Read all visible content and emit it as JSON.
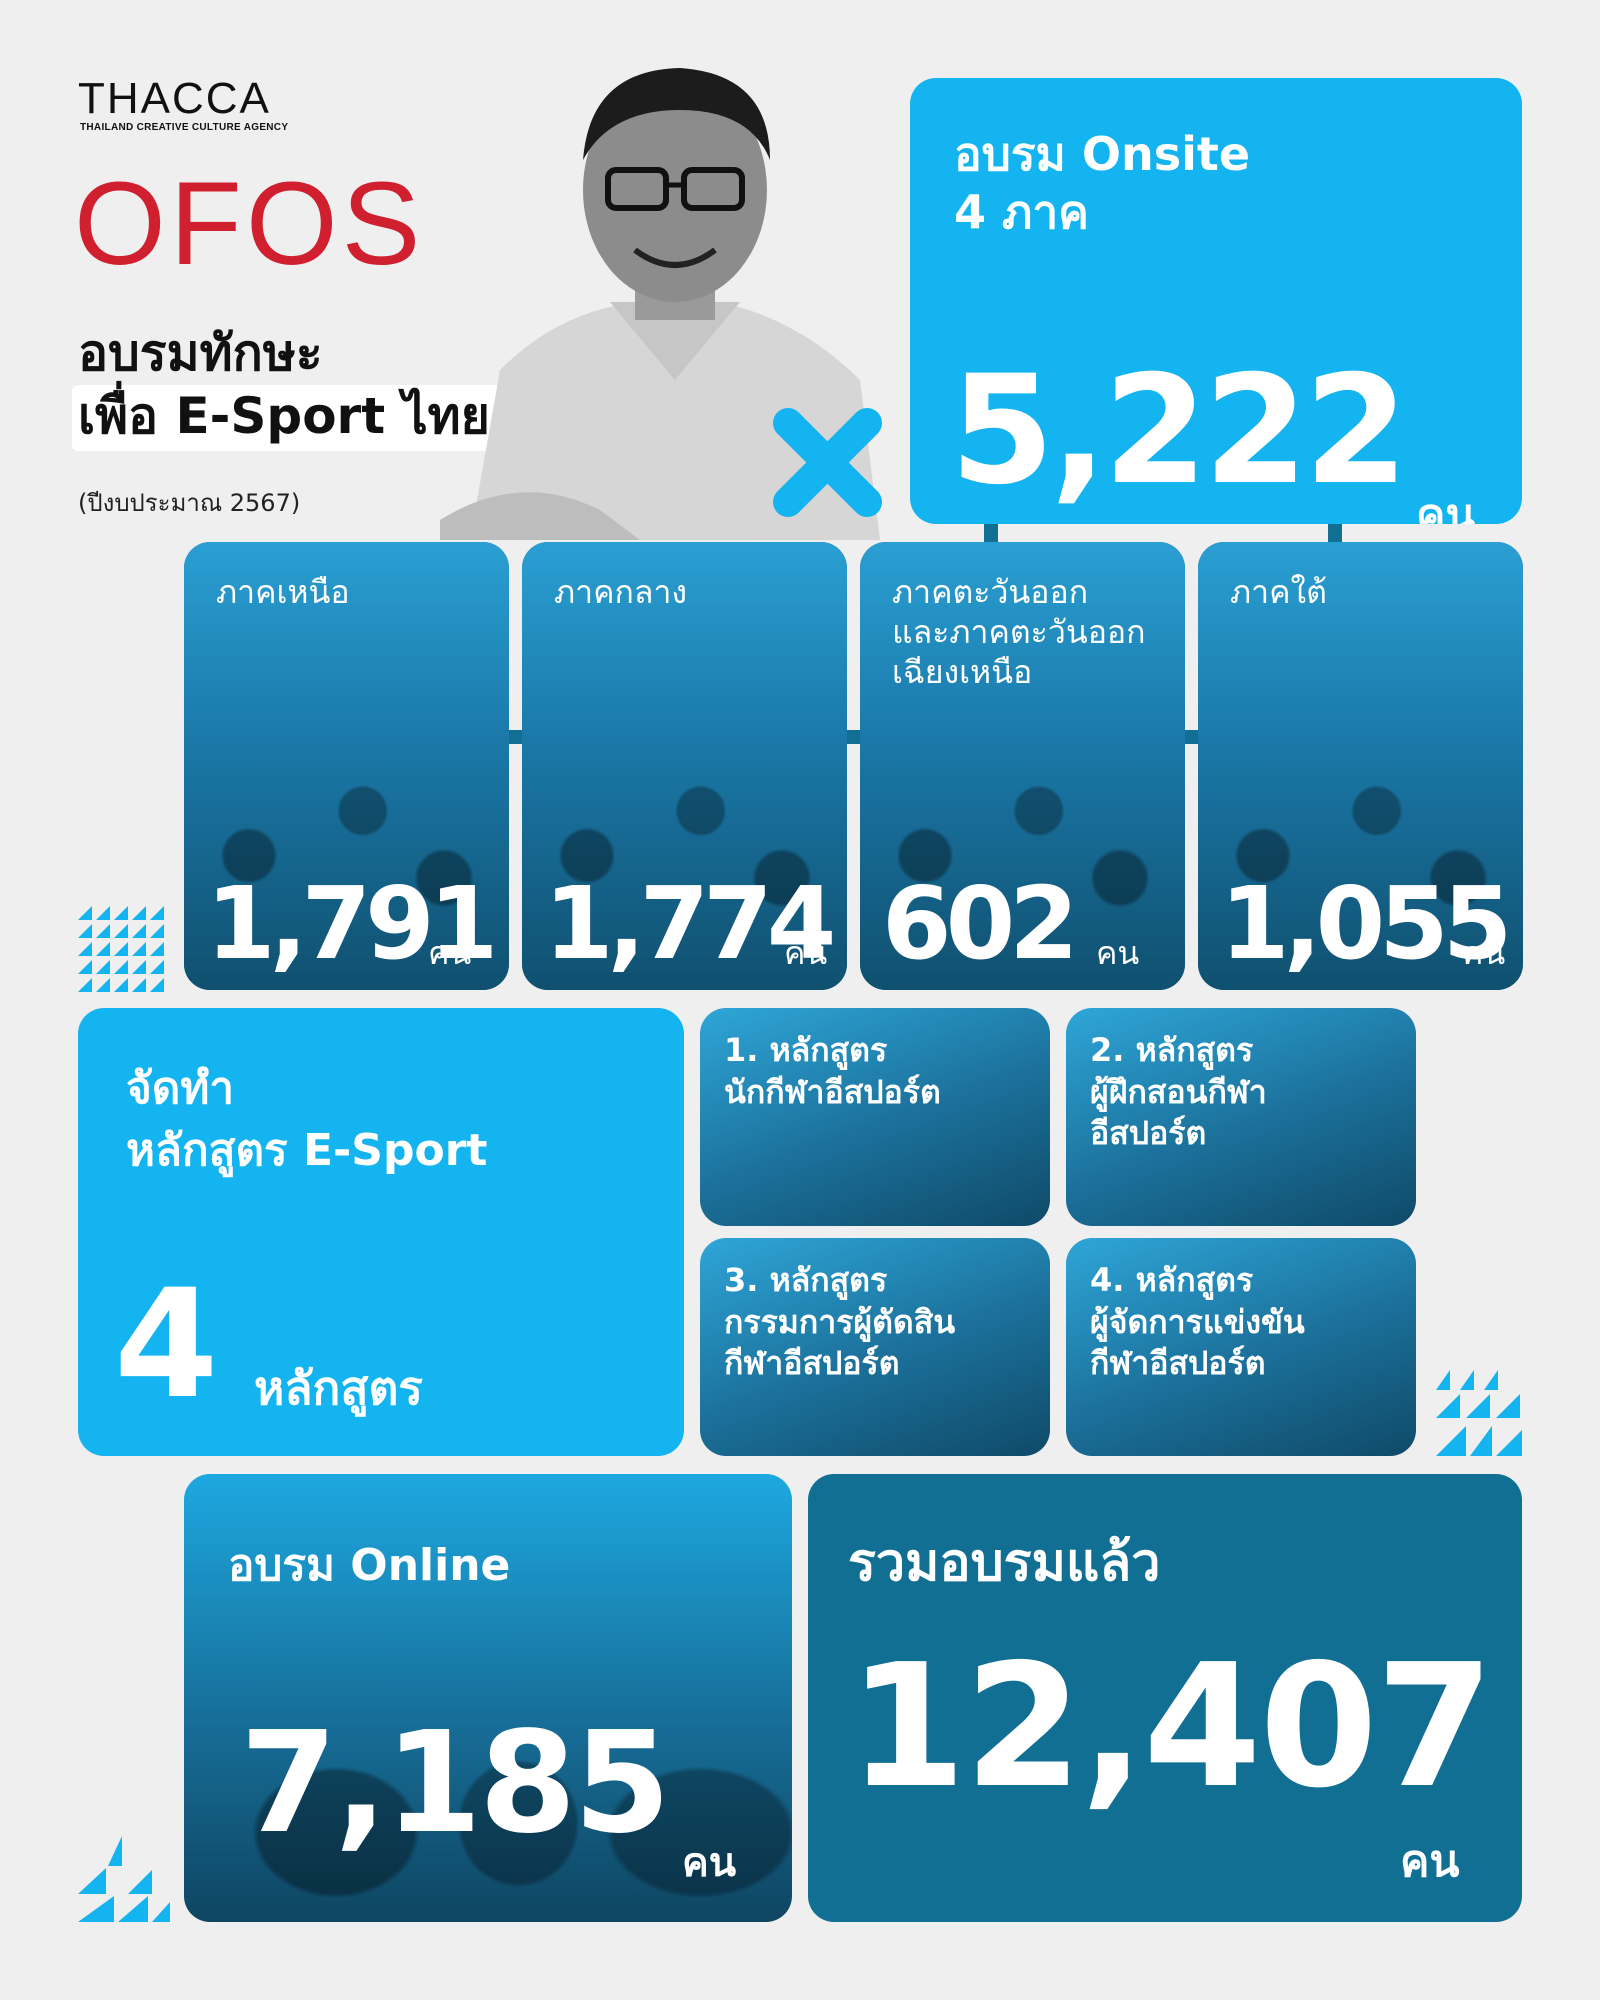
{
  "header": {
    "logo": "THACCA",
    "logo_subtitle": "THAILAND CREATIVE CULTURE AGENCY",
    "program": "OFOS",
    "headline_line1": "อบรมทักษะ",
    "headline_line2": "เพื่อ E-Sport ไทย",
    "budget_note": "(ปีงบประมาณ 2567)"
  },
  "colors": {
    "brand_red": "#d01f2f",
    "accent_blue": "#14b4f0",
    "dark_teal": "#126f94",
    "background": "#efefef"
  },
  "onsite": {
    "title_line1": "อบรม Onsite",
    "title_line2": "4 ภาค",
    "count": "5,222",
    "unit": "คน"
  },
  "regions": [
    {
      "label": "ภาคเหนือ",
      "count": "1,791",
      "unit": "คน"
    },
    {
      "label": "ภาคกลาง",
      "count": "1,774",
      "unit": "คน"
    },
    {
      "label": "ภาคตะวันออก\nและภาคตะวันออก\nเฉียงเหนือ",
      "count": "602",
      "unit": "คน"
    },
    {
      "label": "ภาคใต้",
      "count": "1,055",
      "unit": "คน"
    }
  ],
  "curriculum": {
    "title_line1": "จัดทำ",
    "title_line2": "หลักสูตร E-Sport",
    "count": "4",
    "unit": "หลักสูตร",
    "courses": [
      {
        "label_line1": "1. หลักสูตร",
        "label_line2": "นักกีฬาอีสปอร์ต",
        "label_line3": ""
      },
      {
        "label_line1": "2. หลักสูตร",
        "label_line2": "ผู้ฝึกสอนกีฬา",
        "label_line3": "อีสปอร์ต"
      },
      {
        "label_line1": "3. หลักสูตร",
        "label_line2": "กรรมการผู้ตัดสิน",
        "label_line3": "กีฬาอีสปอร์ต"
      },
      {
        "label_line1": "4. หลักสูตร",
        "label_line2": "ผู้จัดการแข่งขัน",
        "label_line3": "กีฬาอีสปอร์ต"
      }
    ]
  },
  "online": {
    "title": "อบรม Online",
    "count": "7,185",
    "unit": "คน"
  },
  "total": {
    "title": "รวมอบรมแล้ว",
    "count": "12,407",
    "unit": "คน"
  }
}
